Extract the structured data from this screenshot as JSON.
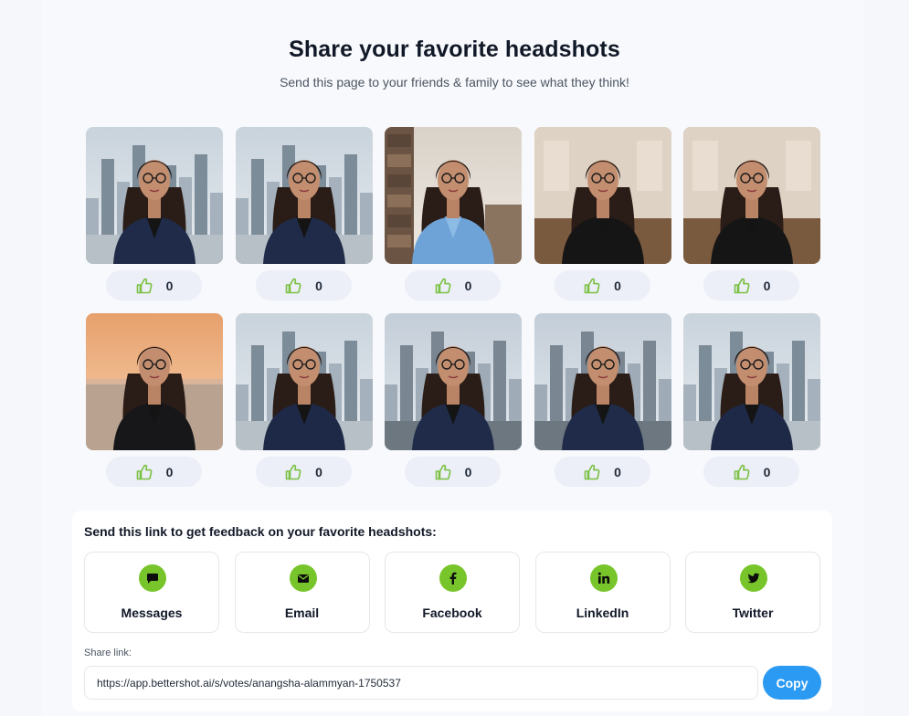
{
  "header": {
    "title": "Share your favorite headshots",
    "subtitle": "Send this page to your friends & family to see what they think!"
  },
  "headshots": [
    {
      "scene": "balcony-city",
      "outfit": "navy-blazer",
      "votes": "0"
    },
    {
      "scene": "balcony-city",
      "outfit": "navy-blazer",
      "votes": "0"
    },
    {
      "scene": "office-bookshelf",
      "outfit": "blue-shirt",
      "votes": "0"
    },
    {
      "scene": "loft-interior",
      "outfit": "leather-jacket",
      "votes": "0"
    },
    {
      "scene": "loft-interior",
      "outfit": "leather-jacket",
      "votes": "0"
    },
    {
      "scene": "beach-sunset",
      "outfit": "black-top",
      "votes": "0"
    },
    {
      "scene": "balcony-city",
      "outfit": "navy-blazer-arms-crossed",
      "votes": "0"
    },
    {
      "scene": "window-city",
      "outfit": "navy-blazer",
      "votes": "0"
    },
    {
      "scene": "window-city",
      "outfit": "navy-blazer",
      "votes": "0"
    },
    {
      "scene": "balcony-city",
      "outfit": "navy-blazer-arms-crossed",
      "votes": "0"
    }
  ],
  "share": {
    "heading": "Send this link to get feedback on your favorite headshots:",
    "options": [
      {
        "label": "Messages",
        "icon": "chat-icon"
      },
      {
        "label": "Email",
        "icon": "email-icon"
      },
      {
        "label": "Facebook",
        "icon": "facebook-icon"
      },
      {
        "label": "LinkedIn",
        "icon": "linkedin-icon"
      },
      {
        "label": "Twitter",
        "icon": "twitter-icon"
      }
    ],
    "link_label": "Share link:",
    "link_value": "https://app.bettershot.ai/s/votes/anangsha-alammyan-1750537",
    "copy_label": "Copy"
  },
  "colors": {
    "accent_green": "#78c52b",
    "copy_blue": "#2b9af3",
    "vote_pill": "#eceef8"
  }
}
